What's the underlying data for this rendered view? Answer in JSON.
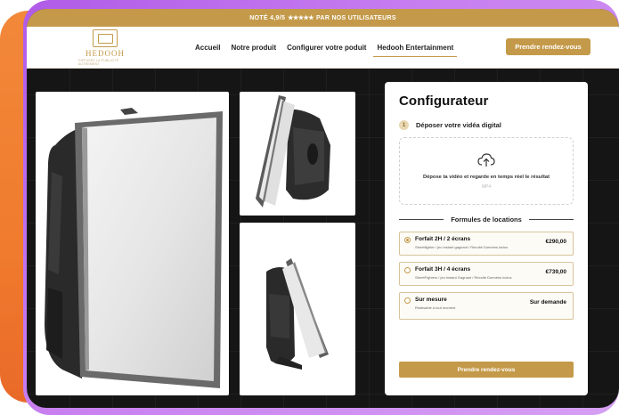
{
  "banner": {
    "prefix": "NOTÉ 4,9/5",
    "stars": "★★★★★",
    "suffix": "PAR NOS UTILISATEURS"
  },
  "logo": {
    "name": "HEDOOH",
    "tagline": "DIFFUSEZ LA PUBLICITÉ AUTREMENT"
  },
  "nav": {
    "items": [
      {
        "label": "Accueil"
      },
      {
        "label": "Notre produit"
      },
      {
        "label": "Configurer votre poduit"
      },
      {
        "label": "Hedooh Entertainment"
      }
    ],
    "cta": "Prendre rendez-vous"
  },
  "configurator": {
    "title": "Configurateur",
    "step": {
      "number": "1",
      "label": "Déposer votre vidéa digital"
    },
    "dropzone": {
      "text": "Dépose ta vidéo et regarde en temps réel le résultat",
      "format": "MP4"
    },
    "plans_title": "Formules de locations",
    "plans": [
      {
        "name": "Forfait 2H / 2 écrans",
        "desc": "Streetfighter / jeu instant gagnant / Récolte Données inclus",
        "price": "€290,00",
        "selected": true
      },
      {
        "name": "Forfait 3H / 4 écrans",
        "desc": "StreetFighters / jeu instant Gagnant / Récolte Données inclus",
        "price": "€739,00",
        "selected": false
      },
      {
        "name": "Sur mesure",
        "desc": "Réalisable à tout moment",
        "price": "Sur demande",
        "selected": false
      }
    ],
    "cta": "Prendre rendez-vous"
  },
  "colors": {
    "gold": "#c49a4a",
    "dark_bg": "#151515"
  }
}
